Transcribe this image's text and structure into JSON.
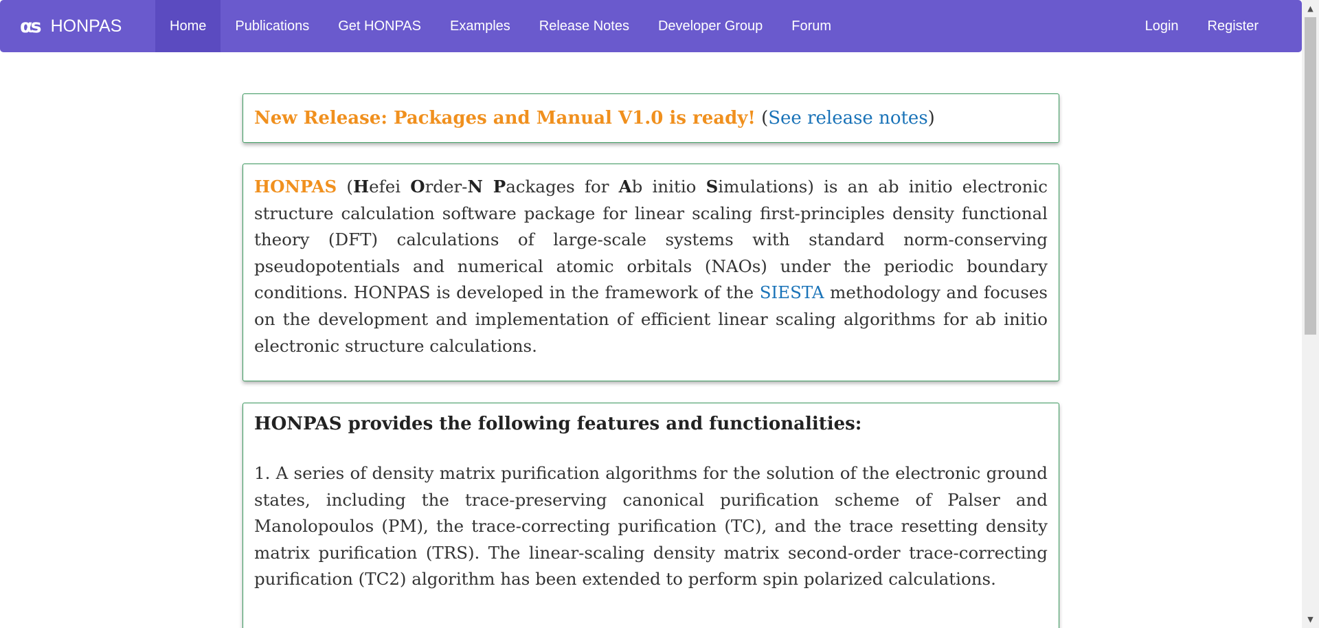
{
  "nav": {
    "logo": "αs",
    "brand": "HONPAS",
    "items": [
      "Home",
      "Publications",
      "Get HONPAS",
      "Examples",
      "Release Notes",
      "Developer Group",
      "Forum"
    ],
    "active": "Home",
    "right": [
      "Login",
      "Register"
    ],
    "bg_color": "#6a5acd"
  },
  "release": {
    "headline": "New Release: Packages and Manual V1.0 is ready!",
    "paren_open": "(",
    "link": "See release notes",
    "paren_close": ")"
  },
  "intro": {
    "name": "HONPAS",
    "paren_open": " (",
    "h_bold": "H",
    "h_rest": "efei ",
    "o_bold": "O",
    "o_rest": "rder-",
    "n_bold": "N",
    "p_bold": " P",
    "p_rest": "ackages for ",
    "a_bold": "A",
    "a_rest": "b initio ",
    "s_bold": "S",
    "s_rest": "imulations)",
    "text_before_link": " is an ab initio electronic structure calculation software package for linear scaling first-principles density functional theory (DFT) calculations of large-scale systems with standard norm-conserving pseudopotentials and numerical atomic orbitals (NAOs) under the periodic boundary conditions. HONPAS is developed in the framework of the ",
    "link": "SIESTA",
    "text_after_link": " methodology and focuses on the development and implementation of efficient linear scaling algorithms for ab initio electronic structure calculations."
  },
  "features": {
    "title": "HONPAS provides the following features and functionalities:",
    "item1": "1. A series of density matrix purification algorithms for the solution of the electronic ground states, including the trace-preserving canonical purification scheme of Palser and Manolopoulos (PM), the trace-correcting purification (TC), and the trace resetting density matrix purification (TRS). The linear-scaling density matrix second-order trace-correcting purification (TC2) algorithm has been extended to perform spin polarized calculations."
  },
  "colors": {
    "accent_orange": "#f0901e",
    "link_blue": "#1a73b8",
    "panel_border": "#3c9a5f"
  }
}
